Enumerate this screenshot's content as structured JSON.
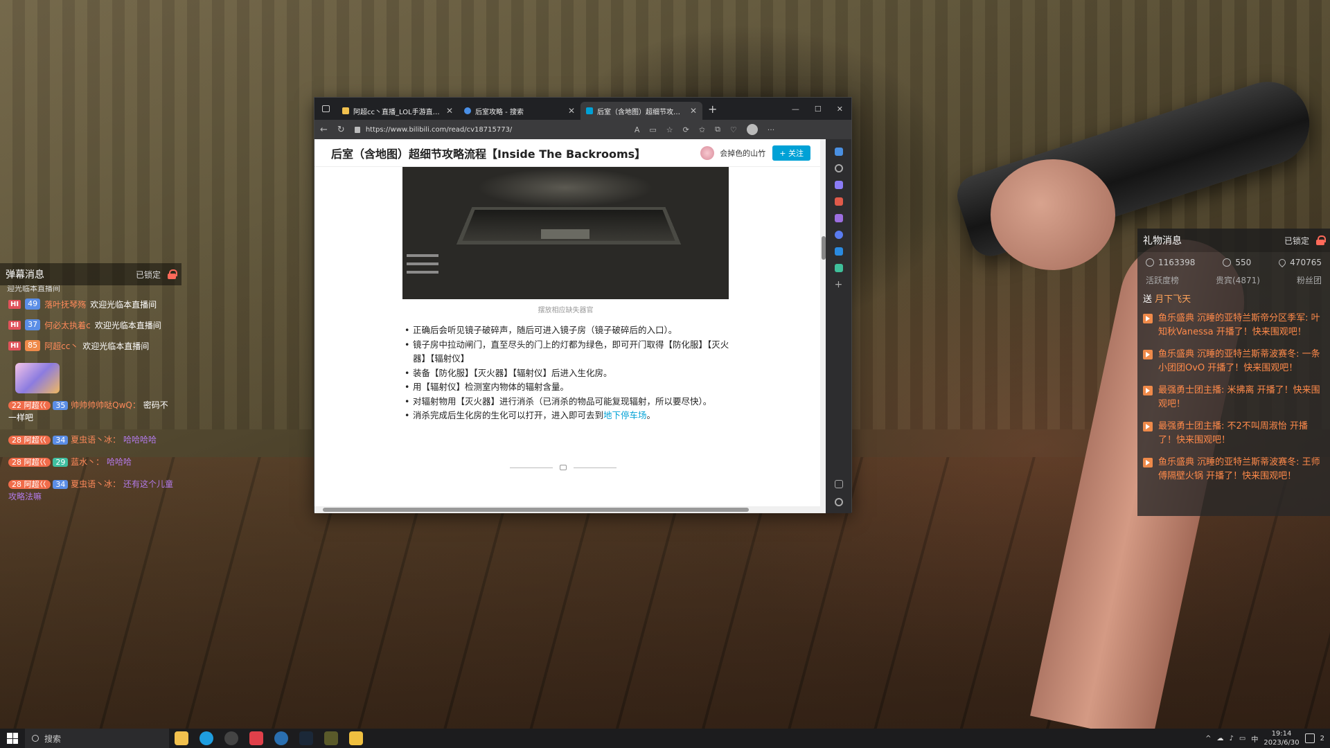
{
  "danmaku": {
    "title": "弹幕消息",
    "lock_text": "已锁定",
    "cut_text": "迎光临本直播间",
    "rows": [
      {
        "badge": "HI",
        "level": "49",
        "user": "落叶抚琴殇",
        "msg": "欢迎光临本直播间"
      },
      {
        "badge": "HI",
        "level": "37",
        "user": "何必太执着c",
        "msg": "欢迎光临本直播间"
      },
      {
        "badge": "HI",
        "level": "85",
        "user": "阿超cc丶",
        "msg": "欢迎光临本直播间"
      }
    ],
    "chat": [
      {
        "fan": "阿超巜",
        "fan_level": "22",
        "level": "35",
        "user": "帅帅帅帅哒QwQ：",
        "msg": "密码不一样吧"
      },
      {
        "fan": "阿超巜",
        "fan_level": "28",
        "level": "34",
        "user": "夏虫语丶冰：",
        "msg": "哈哈哈哈"
      },
      {
        "fan": "阿超巜",
        "fan_level": "28",
        "level": "29",
        "user": "蓝水丶：",
        "msg": "哈哈哈"
      },
      {
        "fan": "阿超巜",
        "fan_level": "28",
        "level": "34",
        "user": "夏虫语丶冰：",
        "msg": "还有这个儿童攻略法嘛"
      }
    ]
  },
  "gift": {
    "title": "礼物消息",
    "lock_text": "已锁定",
    "stats": {
      "fire": "1163398",
      "people": "550",
      "likes": "470765"
    },
    "tabs": [
      "活跃度榜",
      "贵宾(4871)",
      "粉丝团"
    ],
    "send_prefix": "送",
    "send_gift": "月下飞天",
    "rows": [
      "鱼乐盛典 沉睡的亚特兰斯帝分区季军: 叶知秋Vanessa 开播了！快来围观吧！",
      "鱼乐盛典 沉睡的亚特兰斯蒂波赛冬: 一条小团团OvO 开播了！快来围观吧！",
      "最强勇士团主播: 米拂离 开播了！快来围观吧！",
      "最强勇士团主播: 不2不叫周淑怡 开播了！快来围观吧！",
      "鱼乐盛典 沉睡的亚特兰斯蒂波赛冬: 王师傅隔壁火锅 开播了！快来围观吧！"
    ]
  },
  "browser": {
    "tabs": [
      {
        "title": "阿超cc丶直播_LOL手游直播_斗鱼",
        "active": false
      },
      {
        "title": "后室攻略 - 搜索",
        "active": false
      },
      {
        "title": "后室（含地图）超细节攻略流程",
        "active": true
      }
    ],
    "url": "https://www.bilibili.com/read/cv18715773/",
    "article_title": "后室（含地图）超细节攻略流程【Inside The Backrooms】",
    "author": "会掉色的山竹",
    "follow_label": "+ 关注",
    "caption": "摆放相应缺失器官",
    "steps": [
      "正确后会听见镜子破碎声，随后可进入镜子房（镜子破碎后的入口）。",
      "镜子房中拉动闸门，直至尽头的门上的灯都为绿色，即可开门取得【防化服】【灭火器】【辐射仪】",
      "装备【防化服】【灭火器】【辐射仪】后进入生化房。",
      "用【辐射仪】检测室内物体的辐射含量。",
      "对辐射物用【灭火器】进行消杀（已消杀的物品可能复现辐射，所以要尽快）。"
    ],
    "last_step_prefix": "消杀完成后生化房的生化可以打开，进入即可去到",
    "last_step_link": "地下停车场",
    "last_step_suffix": "。"
  },
  "taskbar": {
    "search_label": "搜索",
    "ime": "中",
    "time": "19:14",
    "date": "2023/6/30",
    "notif_count": "2"
  }
}
